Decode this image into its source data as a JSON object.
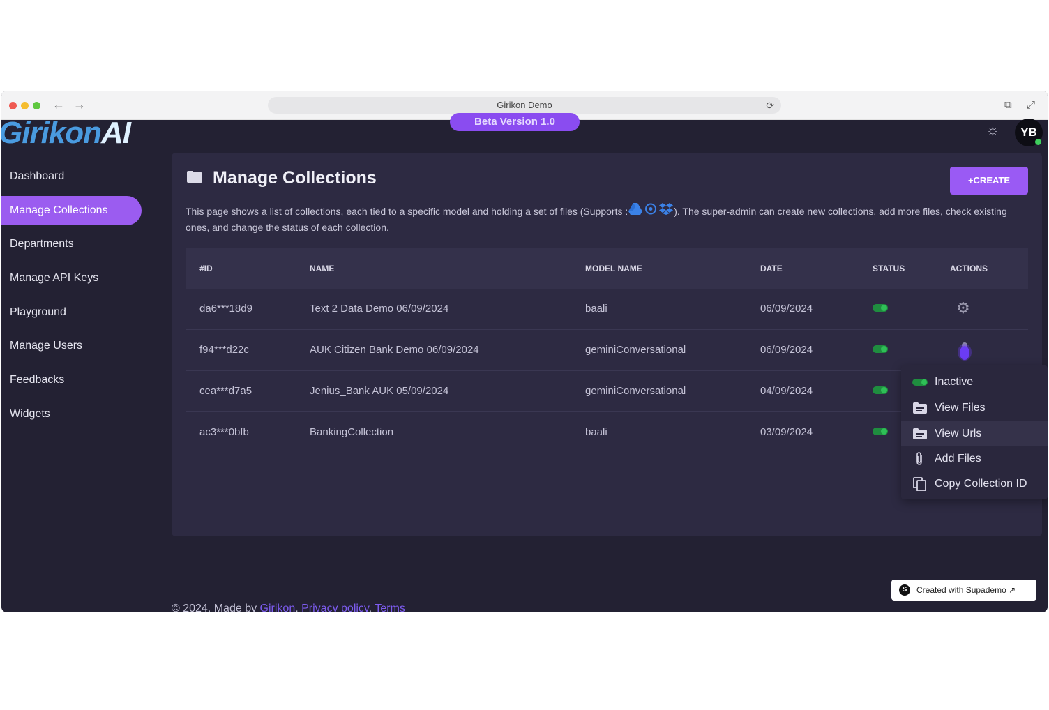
{
  "browser": {
    "tab_title": "Girikon Demo",
    "back_icon": "←",
    "forward_icon": "→",
    "reload_icon": "⟳",
    "external_icon": "⧉",
    "fullscreen_icon": "⤢"
  },
  "header": {
    "logo_text": "GirikonAI",
    "logo_main": "Girikon",
    "logo_ai": "AI",
    "beta_label": "Beta Version 1.0",
    "theme_icon": "☼",
    "avatar_initials": "YB"
  },
  "sidebar": {
    "items": [
      {
        "label": "Dashboard"
      },
      {
        "label": "Manage Collections"
      },
      {
        "label": "Departments"
      },
      {
        "label": "Manage API Keys"
      },
      {
        "label": "Playground"
      },
      {
        "label": "Manage Users"
      },
      {
        "label": "Feedbacks"
      },
      {
        "label": "Widgets"
      }
    ],
    "active_index": 1
  },
  "main": {
    "title": "Manage Collections",
    "create_label": "+CREATE",
    "description_before": "This page shows a list of collections, each tied to a specific model and holding a set of files (Supports :",
    "description_after": "). The super-admin can create new collections, add more files, check existing ones, and change the status of each collection.",
    "supported_sources": [
      "google-drive-icon",
      "onedrive-icon",
      "dropbox-icon"
    ]
  },
  "table": {
    "headers": [
      "#ID",
      "NAME",
      "MODEL NAME",
      "DATE",
      "STATUS",
      "ACTIONS"
    ],
    "rows": [
      {
        "id": "da6***18d9",
        "name": "Text 2 Data Demo 06/09/2024",
        "model": "baali",
        "date": "06/09/2024",
        "status": "active"
      },
      {
        "id": "f94***d22c",
        "name": "AUK Citizen Bank Demo 06/09/2024",
        "model": "geminiConversational",
        "date": "06/09/2024",
        "status": "active"
      },
      {
        "id": "cea***d7a5",
        "name": "Jenius_Bank AUK 05/09/2024",
        "model": "geminiConversational",
        "date": "04/09/2024",
        "status": "active"
      },
      {
        "id": "ac3***0bfb",
        "name": "BankingCollection",
        "model": "baali",
        "date": "03/09/2024",
        "status": "active"
      }
    ]
  },
  "action_menu": {
    "items": [
      {
        "label": "Inactive",
        "icon": "toggle-icon"
      },
      {
        "label": "View Files",
        "icon": "folder-icon"
      },
      {
        "label": "View Urls",
        "icon": "folder-icon"
      },
      {
        "label": "Add Files",
        "icon": "paperclip-icon"
      },
      {
        "label": "Copy Collection ID",
        "icon": "copy-icon"
      }
    ],
    "hovered_index": 2
  },
  "footer": {
    "prefix": "© 2024, Made by",
    "company": "Girikon",
    "privacy": "Privacy policy",
    "terms": "Terms"
  },
  "supademo": {
    "label": "Created with Supademo ↗"
  },
  "colors": {
    "accent": "#9b5cf0",
    "background": "#232133",
    "panel": "#2d2a42",
    "status_green": "#2fbf57"
  }
}
